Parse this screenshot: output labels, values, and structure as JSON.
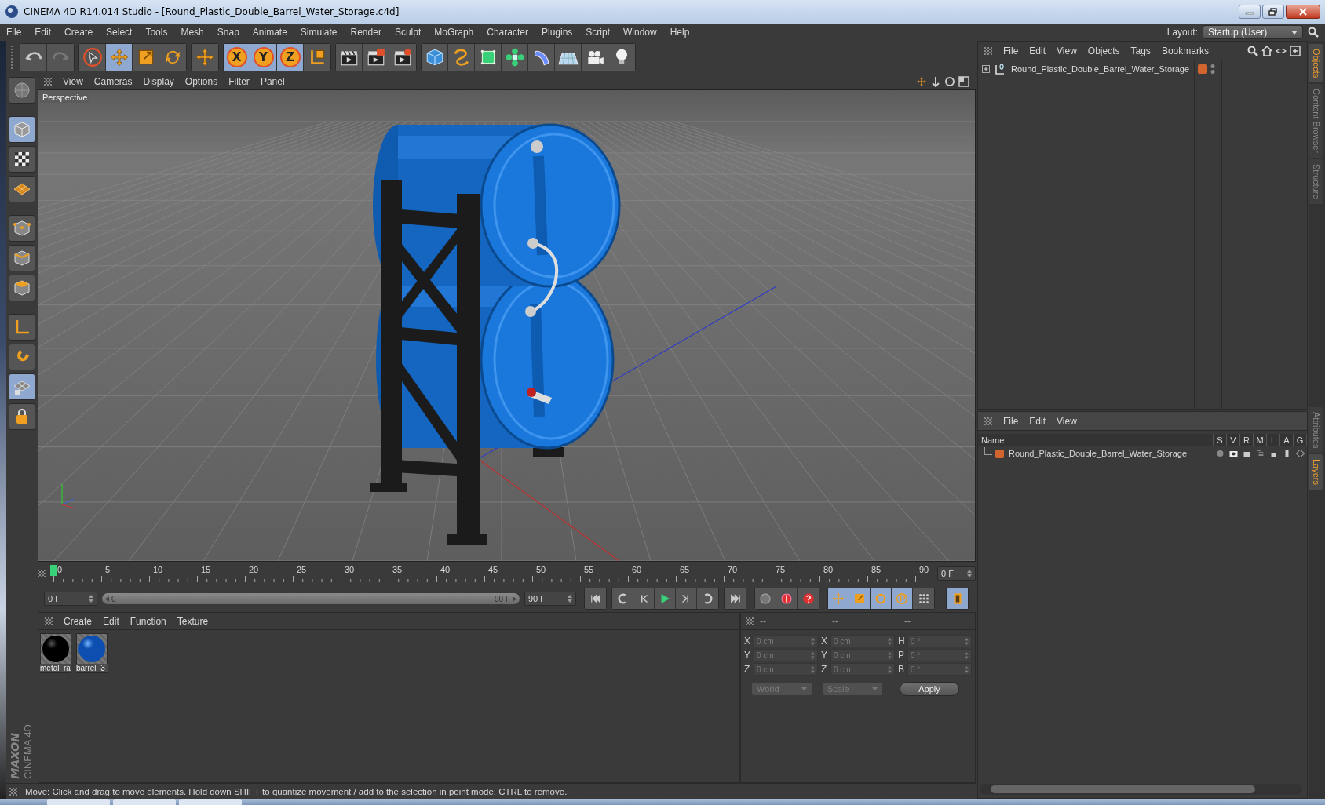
{
  "window": {
    "title": "CINEMA 4D R14.014 Studio - [Round_Plastic_Double_Barrel_Water_Storage.c4d]"
  },
  "menu": [
    "File",
    "Edit",
    "Create",
    "Select",
    "Tools",
    "Mesh",
    "Snap",
    "Animate",
    "Simulate",
    "Render",
    "Sculpt",
    "MoGraph",
    "Character",
    "Plugins",
    "Script",
    "Window",
    "Help"
  ],
  "layout": {
    "label": "Layout:",
    "value": "Startup (User)"
  },
  "toolbar": [
    [
      {
        "kind": "undo",
        "selected": false
      },
      {
        "kind": "redo",
        "selected": false
      }
    ],
    [
      {
        "kind": "live-select",
        "selected": false
      },
      {
        "kind": "move",
        "selected": true
      },
      {
        "kind": "scale",
        "selected": false
      },
      {
        "kind": "rotate",
        "selected": false
      }
    ],
    [
      {
        "kind": "add",
        "selected": false
      }
    ],
    [
      {
        "kind": "axis",
        "label": "X",
        "selected": true
      },
      {
        "kind": "axis",
        "label": "Y",
        "selected": true
      },
      {
        "kind": "axis",
        "label": "Z",
        "selected": true
      },
      {
        "kind": "coord",
        "selected": false
      }
    ],
    [
      {
        "kind": "render-view",
        "selected": false
      },
      {
        "kind": "render",
        "selected": false
      },
      {
        "kind": "render-settings",
        "selected": false
      }
    ],
    [
      {
        "kind": "cube",
        "selected": false
      },
      {
        "kind": "spline",
        "selected": false
      },
      {
        "kind": "nurbs",
        "selected": false
      },
      {
        "kind": "array",
        "selected": false
      },
      {
        "kind": "deformer",
        "selected": false
      },
      {
        "kind": "floor",
        "selected": false
      },
      {
        "kind": "camera",
        "selected": false
      },
      {
        "kind": "light",
        "selected": false
      }
    ]
  ],
  "left_tools": [
    {
      "kind": "view",
      "selected": false
    },
    {
      "kind": "model",
      "selected": true
    },
    {
      "kind": "texture",
      "selected": false
    },
    {
      "kind": "workplane",
      "selected": false
    },
    {
      "kind": "points",
      "selected": false
    },
    {
      "kind": "edges",
      "selected": false
    },
    {
      "kind": "polygons",
      "selected": false
    },
    {
      "kind": "axis",
      "selected": false
    },
    {
      "kind": "magnet",
      "selected": false
    },
    {
      "kind": "snap",
      "selected": true
    },
    {
      "kind": "lock",
      "selected": false
    }
  ],
  "viewport": {
    "menu": [
      "View",
      "Cameras",
      "Display",
      "Options",
      "Filter",
      "Panel"
    ],
    "camera_label": "Perspective"
  },
  "timeline": {
    "range": {
      "level": 1
    },
    "ticks": [
      "0",
      "5",
      "10",
      "15",
      "20",
      "25",
      "30",
      "35",
      "40",
      "45",
      "50",
      "55",
      "60",
      "65",
      "70",
      "75",
      "80",
      "85",
      "90"
    ],
    "playhead": {
      "level": 0
    },
    "current_frame": "0 F",
    "start_field": "0 F",
    "range_start": "0 F",
    "range_end": "90 F",
    "end_field": "90 F"
  },
  "transport": [
    {
      "kind": "first"
    },
    {
      "kind": "prev-key"
    },
    {
      "kind": "prev-frame"
    },
    {
      "kind": "play"
    },
    {
      "kind": "next-frame"
    },
    {
      "kind": "next-key"
    },
    {
      "kind": "last"
    }
  ],
  "record": [
    {
      "kind": "auto-key"
    },
    {
      "kind": "record"
    },
    {
      "kind": "help"
    }
  ],
  "keys": [
    {
      "kind": "key-move",
      "selected": true
    },
    {
      "kind": "key-scale",
      "selected": true
    },
    {
      "kind": "key-rotate",
      "selected": true
    },
    {
      "kind": "key-param",
      "selected": true
    },
    {
      "kind": "key-grid",
      "selected": false
    },
    {
      "kind": "timeline",
      "selected": true
    }
  ],
  "materials": {
    "menu": [
      "Create",
      "Edit",
      "Function",
      "Texture"
    ],
    "items": [
      {
        "name": "metal_ra",
        "kind": "black"
      },
      {
        "name": "barrel_3",
        "kind": "blue"
      }
    ]
  },
  "coordinates": {
    "disabled": true,
    "headers": [
      "--",
      "--",
      "--"
    ],
    "columns": [
      [
        {
          "axis": "X",
          "value": "0 cm"
        },
        {
          "axis": "Y",
          "value": "0 cm"
        },
        {
          "axis": "Z",
          "value": "0 cm"
        }
      ],
      [
        {
          "axis": "X",
          "value": "0 cm"
        },
        {
          "axis": "Y",
          "value": "0 cm"
        },
        {
          "axis": "Z",
          "value": "0 cm"
        }
      ],
      [
        {
          "axis": "H",
          "value": "0 °"
        },
        {
          "axis": "P",
          "value": "0 °"
        },
        {
          "axis": "B",
          "value": "0 °"
        }
      ]
    ],
    "mode": "World",
    "size_mode": "Scale",
    "apply": "Apply"
  },
  "objects": {
    "menu": [
      "File",
      "Edit",
      "View",
      "Objects",
      "Tags",
      "Bookmarks"
    ],
    "items": [
      {
        "name": "Round_Plastic_Double_Barrel_Water_Storage",
        "color": "#d2642e",
        "expanded": false
      }
    ]
  },
  "layers": {
    "menu": [
      "File",
      "Edit",
      "View"
    ],
    "columns": [
      "Name",
      "S",
      "V",
      "R",
      "M",
      "L",
      "A",
      "G"
    ],
    "items": [
      {
        "name": "Round_Plastic_Double_Barrel_Water_Storage",
        "color": "#d2642e"
      }
    ]
  },
  "side_tabs_top": [
    {
      "label": "Objects",
      "selected": true
    },
    {
      "label": "Content Browser",
      "selected": false
    },
    {
      "label": "Structure",
      "selected": false
    }
  ],
  "side_tabs_bottom": [
    {
      "label": "Attributes",
      "selected": false
    },
    {
      "label": "Layers",
      "selected": true
    }
  ],
  "brand": {
    "maker": "MAXON",
    "product": "CINEMA 4D"
  },
  "status": "Move: Click and drag to move elements. Hold down SHIFT to quantize movement / add to the selection in point mode, CTRL to remove."
}
